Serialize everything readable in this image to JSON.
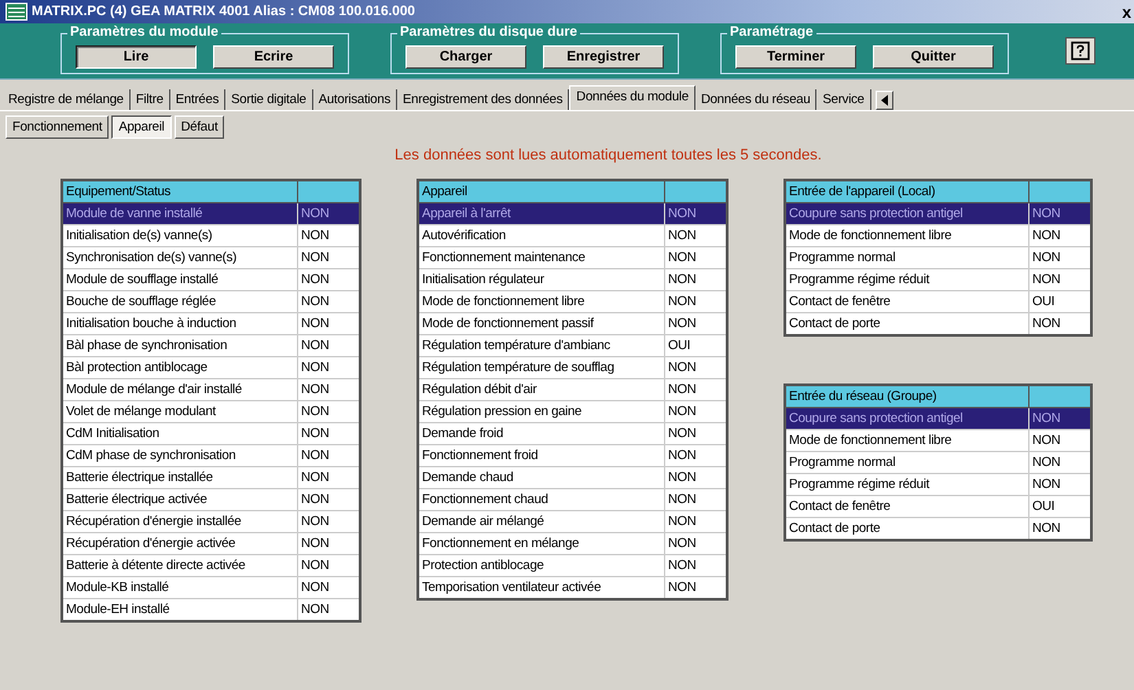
{
  "window": {
    "title": "MATRIX.PC (4)   GEA MATRIX 4001   Alias : CM08 100.016.000",
    "close": "x"
  },
  "toolbar": [
    {
      "legend": "Paramètres du module",
      "buttons": [
        {
          "label": "Lire",
          "selected": true
        },
        {
          "label": "Ecrire",
          "selected": false
        }
      ]
    },
    {
      "legend": "Paramètres du disque dure",
      "buttons": [
        {
          "label": "Charger",
          "selected": false
        },
        {
          "label": "Enregistrer",
          "selected": false
        }
      ]
    },
    {
      "legend": "Paramétrage",
      "buttons": [
        {
          "label": "Terminer",
          "selected": false
        },
        {
          "label": "Quitter",
          "selected": false
        }
      ]
    }
  ],
  "tabs": [
    {
      "label": "Registre de mélange",
      "selected": false
    },
    {
      "label": "Filtre",
      "selected": false
    },
    {
      "label": "Entrées",
      "selected": false
    },
    {
      "label": "Sortie digitale",
      "selected": false
    },
    {
      "label": "Autorisations",
      "selected": false
    },
    {
      "label": "Enregistrement des données",
      "selected": false
    },
    {
      "label": "Données du module",
      "selected": true
    },
    {
      "label": "Données du réseau",
      "selected": false
    },
    {
      "label": "Service",
      "selected": false
    }
  ],
  "subtabs": [
    {
      "label": "Fonctionnement",
      "selected": false
    },
    {
      "label": "Appareil",
      "selected": true
    },
    {
      "label": "Défaut",
      "selected": false
    }
  ],
  "message": "Les données sont lues automatiquement toutes les 5 secondes.",
  "columns": [
    [
      {
        "heading": "Equipement/Status",
        "rows": [
          {
            "label": "Module de vanne installé",
            "value": "NON",
            "selected": true
          },
          {
            "label": "Initialisation de(s) vanne(s)",
            "value": "NON",
            "selected": false
          },
          {
            "label": "Synchronisation de(s) vanne(s)",
            "value": "NON",
            "selected": false
          },
          {
            "label": "Module de soufflage installé",
            "value": "NON",
            "selected": false
          },
          {
            "label": "Bouche de soufflage réglée",
            "value": "NON",
            "selected": false
          },
          {
            "label": "Initialisation bouche à induction",
            "value": "NON",
            "selected": false
          },
          {
            "label": "Bàl phase de synchronisation",
            "value": "NON",
            "selected": false
          },
          {
            "label": "Bàl protection antiblocage",
            "value": "NON",
            "selected": false
          },
          {
            "label": "Module de mélange d'air installé",
            "value": "NON",
            "selected": false
          },
          {
            "label": "Volet de mélange modulant",
            "value": "NON",
            "selected": false
          },
          {
            "label": "CdM Initialisation",
            "value": "NON",
            "selected": false
          },
          {
            "label": "CdM phase de synchronisation",
            "value": "NON",
            "selected": false
          },
          {
            "label": "Batterie électrique installée",
            "value": "NON",
            "selected": false
          },
          {
            "label": "Batterie électrique activée",
            "value": "NON",
            "selected": false
          },
          {
            "label": "Récupération d'énergie installée",
            "value": "NON",
            "selected": false
          },
          {
            "label": "Récupération d'énergie activée",
            "value": "NON",
            "selected": false
          },
          {
            "label": "Batterie à détente directe activée",
            "value": "NON",
            "selected": false
          },
          {
            "label": "Module-KB installé",
            "value": "NON",
            "selected": false
          },
          {
            "label": "Module-EH installé",
            "value": "NON",
            "selected": false
          }
        ]
      }
    ],
    [
      {
        "heading": "Appareil",
        "rows": [
          {
            "label": "Appareil à l'arrêt",
            "value": "NON",
            "selected": true
          },
          {
            "label": "Autovérification",
            "value": "NON",
            "selected": false
          },
          {
            "label": "Fonctionnement maintenance",
            "value": "NON",
            "selected": false
          },
          {
            "label": "Initialisation régulateur",
            "value": "NON",
            "selected": false
          },
          {
            "label": "Mode de fonctionnement libre",
            "value": "NON",
            "selected": false
          },
          {
            "label": "Mode de fonctionnement passif",
            "value": "NON",
            "selected": false
          },
          {
            "label": "Régulation température d'ambianc",
            "value": "OUI",
            "selected": false
          },
          {
            "label": "Régulation température de soufflag",
            "value": "NON",
            "selected": false
          },
          {
            "label": "Régulation débit d'air",
            "value": "NON",
            "selected": false
          },
          {
            "label": "Régulation pression en gaine",
            "value": "NON",
            "selected": false
          },
          {
            "label": "Demande froid",
            "value": "NON",
            "selected": false
          },
          {
            "label": "Fonctionnement froid",
            "value": "NON",
            "selected": false
          },
          {
            "label": "Demande chaud",
            "value": "NON",
            "selected": false
          },
          {
            "label": "Fonctionnement chaud",
            "value": "NON",
            "selected": false
          },
          {
            "label": "Demande air mélangé",
            "value": "NON",
            "selected": false
          },
          {
            "label": "Fonctionnement en mélange",
            "value": "NON",
            "selected": false
          },
          {
            "label": "Protection antiblocage",
            "value": "NON",
            "selected": false
          },
          {
            "label": "Temporisation ventilateur activée",
            "value": "NON",
            "selected": false
          }
        ]
      }
    ],
    [
      {
        "heading": "Entrée de l'appareil (Local)",
        "rows": [
          {
            "label": "Coupure sans protection antigel",
            "value": "NON",
            "selected": true
          },
          {
            "label": "Mode de fonctionnement libre",
            "value": "NON",
            "selected": false
          },
          {
            "label": "Programme normal",
            "value": "NON",
            "selected": false
          },
          {
            "label": "Programme régime réduit",
            "value": "NON",
            "selected": false
          },
          {
            "label": "Contact de fenêtre",
            "value": "OUI",
            "selected": false
          },
          {
            "label": "Contact de porte",
            "value": "NON",
            "selected": false
          }
        ]
      },
      {
        "heading": "Entrée du réseau (Groupe)",
        "rows": [
          {
            "label": "Coupure sans protection antigel",
            "value": "NON",
            "selected": true
          },
          {
            "label": "Mode de fonctionnement libre",
            "value": "NON",
            "selected": false
          },
          {
            "label": "Programme normal",
            "value": "NON",
            "selected": false
          },
          {
            "label": "Programme régime réduit",
            "value": "NON",
            "selected": false
          },
          {
            "label": "Contact de fenêtre",
            "value": "OUI",
            "selected": false
          },
          {
            "label": "Contact de porte",
            "value": "NON",
            "selected": false
          }
        ]
      }
    ]
  ]
}
